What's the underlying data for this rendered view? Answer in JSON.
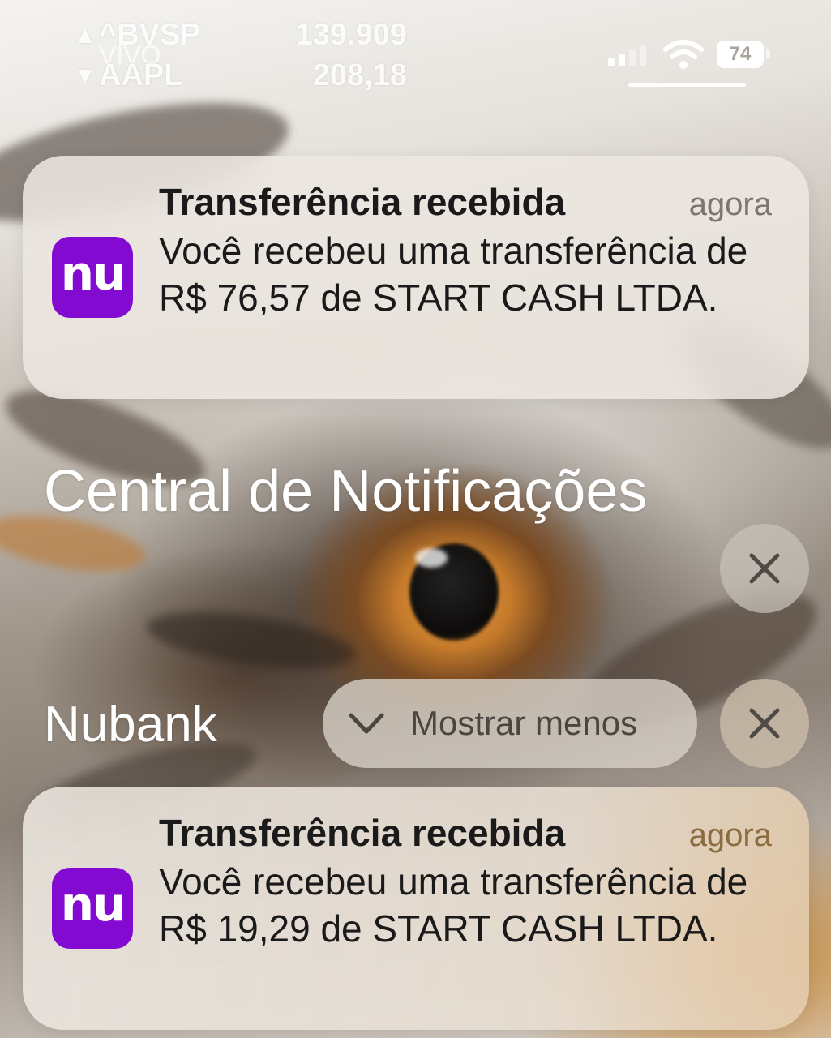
{
  "status_bar": {
    "tickers": [
      {
        "direction": "▲",
        "symbol": "^BVSP",
        "value": "139.909"
      },
      {
        "direction": "▼",
        "symbol": "AAPL",
        "value": "208,18"
      }
    ],
    "carrier": "VIVO",
    "battery": "74",
    "signal_icon": "signal-bars-icon",
    "wifi_icon": "wifi-icon"
  },
  "notifications_top": {
    "title": "Transferência recebida",
    "time": "agora",
    "body": "Você recebeu uma transferência de R$ 76,57 de START CASH LTDA.",
    "app_icon_text": "nu"
  },
  "notification_center": {
    "title": "Central de Notificações",
    "clear_icon": "close-icon"
  },
  "group": {
    "name": "Nubank",
    "show_less_label": "Mostrar menos",
    "chevron_icon": "chevron-down-icon",
    "close_icon": "close-icon",
    "notification": {
      "title": "Transferência recebida",
      "time": "agora",
      "body": "Você recebeu uma transferência de R$ 19,29 de START CASH LTDA.",
      "app_icon_text": "nu"
    }
  },
  "colors": {
    "nubank_purple": "#820ad1",
    "card_background": "#ece8e1",
    "text_primary": "#1a1a1a",
    "text_secondary": "#7b766e"
  }
}
